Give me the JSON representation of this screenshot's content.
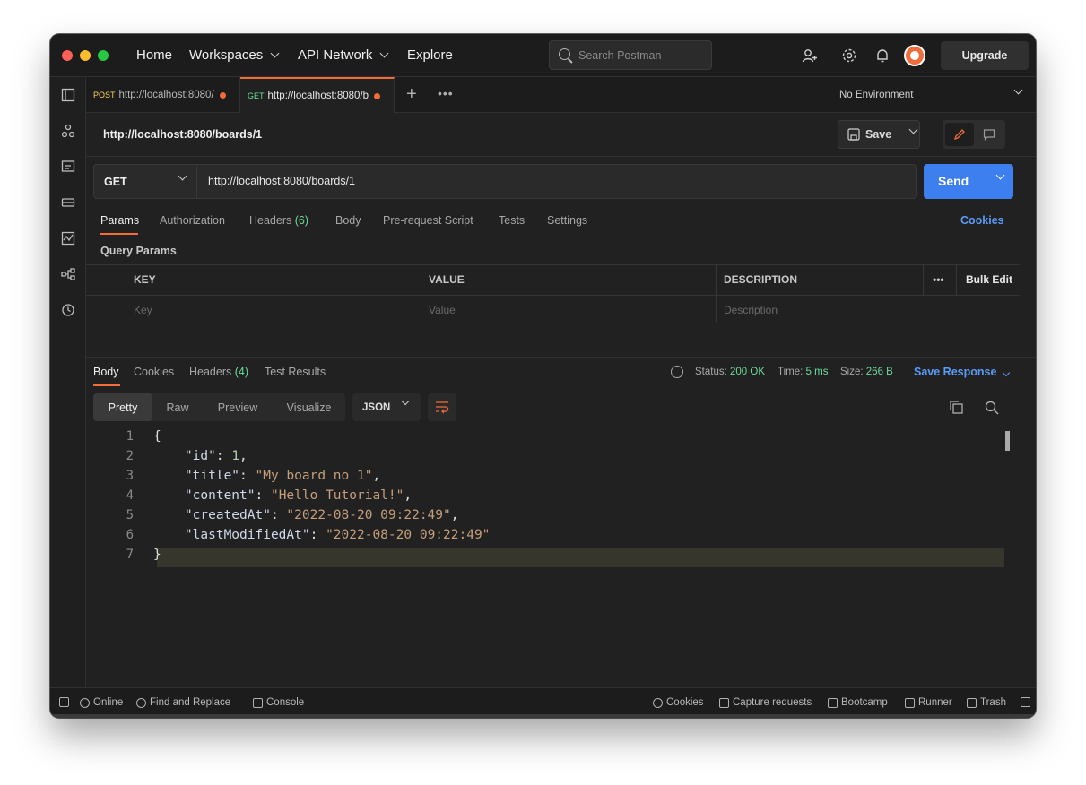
{
  "topbar": {
    "nav": [
      "Home",
      "Workspaces",
      "API Network",
      "Explore"
    ],
    "search_placeholder": "Search Postman",
    "upgrade": "Upgrade"
  },
  "tabs": [
    {
      "method": "POST",
      "url": "http://localhost:8080/"
    },
    {
      "method": "GET",
      "url": "http://localhost:8080/b"
    }
  ],
  "environment": "No Environment",
  "request": {
    "title": "http://localhost:8080/boards/1",
    "save": "Save",
    "method": "GET",
    "url": "http://localhost:8080/boards/1",
    "send": "Send"
  },
  "request_tabs": {
    "params": "Params",
    "authorization": "Authorization",
    "headers": "Headers",
    "headers_count": "(6)",
    "body": "Body",
    "prerequest": "Pre-request Script",
    "tests": "Tests",
    "settings": "Settings",
    "cookies": "Cookies"
  },
  "query_params": {
    "title": "Query Params",
    "headers": {
      "key": "KEY",
      "value": "VALUE",
      "description": "DESCRIPTION",
      "more": "•••",
      "bulk_edit": "Bulk Edit"
    },
    "placeholders": {
      "key": "Key",
      "value": "Value",
      "description": "Description"
    }
  },
  "response": {
    "tabs": {
      "body": "Body",
      "cookies": "Cookies",
      "headers": "Headers",
      "headers_count": "(4)",
      "tests": "Test Results"
    },
    "status_label": "Status:",
    "status_value": "200 OK",
    "time_label": "Time:",
    "time_value": "5 ms",
    "size_label": "Size:",
    "size_value": "266 B",
    "save_response": "Save Response",
    "views": [
      "Pretty",
      "Raw",
      "Preview",
      "Visualize"
    ],
    "format": "JSON",
    "lines": [
      {
        "num": "1",
        "text": "{"
      },
      {
        "num": "2",
        "key": "\"id\"",
        "value": "1",
        "type": "number",
        "comma": ","
      },
      {
        "num": "3",
        "key": "\"title\"",
        "value": "\"My board no 1\"",
        "type": "string",
        "comma": ","
      },
      {
        "num": "4",
        "key": "\"content\"",
        "value": "\"Hello Tutorial!\"",
        "type": "string",
        "comma": ","
      },
      {
        "num": "5",
        "key": "\"createdAt\"",
        "value": "\"2022-08-20 09:22:49\"",
        "type": "string",
        "comma": ","
      },
      {
        "num": "6",
        "key": "\"lastModifiedAt\"",
        "value": "\"2022-08-20 09:22:49\"",
        "type": "string",
        "comma": ""
      },
      {
        "num": "7",
        "text": "}"
      }
    ]
  },
  "footer": {
    "online": "Online",
    "find_replace": "Find and Replace",
    "console": "Console",
    "cookies": "Cookies",
    "capture": "Capture requests",
    "bootcamp": "Bootcamp",
    "runner": "Runner",
    "trash": "Trash"
  }
}
